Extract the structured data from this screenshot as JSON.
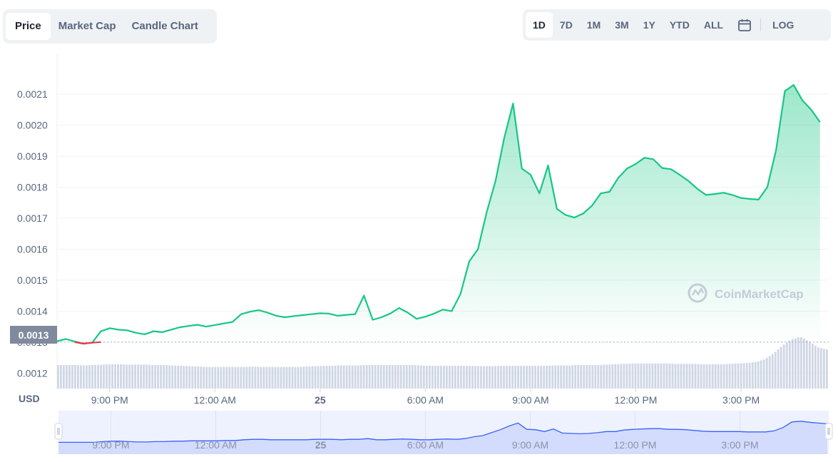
{
  "tabs": {
    "price": "Price",
    "market_cap": "Market Cap",
    "candle_chart": "Candle Chart"
  },
  "ranges": {
    "d1": "1D",
    "d7": "7D",
    "m1": "1M",
    "m3": "3M",
    "y1": "1Y",
    "ytd": "YTD",
    "all": "ALL",
    "log": "LOG"
  },
  "watermark": "CoinMarketCap",
  "currency_label": "USD",
  "colors": {
    "up": "#16c784",
    "down": "#ea3943",
    "navigator_line": "#3861fb",
    "volume": "#cfd6e4"
  },
  "chart_data": {
    "type": "area",
    "ylim": [
      0.00115,
      0.00222
    ],
    "y_ticks": [
      "0.0012",
      "0.0013",
      "0.0014",
      "0.0015",
      "0.0016",
      "0.0017",
      "0.0018",
      "0.0019",
      "0.0020",
      "0.0021"
    ],
    "x_ticks": [
      "9:00 PM",
      "12:00 AM",
      "25",
      "6:00 AM",
      "9:00 AM",
      "12:00 PM",
      "3:00 PM"
    ],
    "open_price": 0.0013,
    "open_price_label": "0.0013",
    "grid": true,
    "series": [
      {
        "x": [
          "7:30 PM",
          "7:45 PM",
          "8:00 PM",
          "8:15 PM",
          "8:30 PM",
          "8:45 PM",
          "9:00 PM",
          "9:15 PM",
          "9:30 PM",
          "9:45 PM",
          "10:00 PM",
          "10:15 PM",
          "10:30 PM",
          "10:45 PM",
          "11:00 PM",
          "11:15 PM",
          "11:30 PM",
          "11:45 PM",
          "12:00 AM",
          "12:15 AM",
          "12:30 AM",
          "12:45 AM",
          "1:00 AM",
          "1:15 AM",
          "1:30 AM",
          "1:45 AM",
          "2:00 AM",
          "2:15 AM",
          "2:30 AM",
          "2:45 AM",
          "3:00 AM",
          "3:15 AM",
          "3:30 AM",
          "3:45 AM",
          "4:00 AM",
          "4:15 AM",
          "4:30 AM",
          "4:45 AM",
          "5:00 AM",
          "5:15 AM",
          "5:30 AM",
          "5:45 AM",
          "6:00 AM",
          "6:15 AM",
          "6:30 AM",
          "6:45 AM",
          "7:00 AM",
          "7:15 AM",
          "7:30 AM",
          "7:45 AM",
          "8:00 AM",
          "8:15 AM",
          "8:30 AM",
          "8:45 AM",
          "9:00 AM",
          "9:15 AM",
          "9:30 AM",
          "9:45 AM",
          "10:00 AM",
          "10:15 AM",
          "10:30 AM",
          "10:45 AM",
          "11:00 AM",
          "11:15 AM",
          "11:30 AM",
          "11:45 AM",
          "12:00 PM",
          "12:15 PM",
          "12:30 PM",
          "12:45 PM",
          "1:00 PM",
          "1:15 PM",
          "1:30 PM",
          "1:45 PM",
          "2:00 PM",
          "2:15 PM",
          "2:30 PM",
          "2:45 PM",
          "3:00 PM",
          "3:15 PM",
          "3:30 PM",
          "3:45 PM",
          "4:00 PM",
          "4:15 PM",
          "4:30 PM",
          "4:45 PM",
          "5:00 PM",
          "5:15 PM"
        ],
        "values": [
          0.001303,
          0.00131,
          0.001302,
          0.001295,
          0.001298,
          0.001335,
          0.001345,
          0.00134,
          0.001338,
          0.00133,
          0.001325,
          0.001335,
          0.001332,
          0.00134,
          0.001348,
          0.001352,
          0.001356,
          0.00135,
          0.001355,
          0.00136,
          0.001365,
          0.00139,
          0.001398,
          0.001403,
          0.001395,
          0.001385,
          0.00138,
          0.001384,
          0.001387,
          0.00139,
          0.001393,
          0.001392,
          0.001385,
          0.001388,
          0.00139,
          0.00145,
          0.001372,
          0.00138,
          0.001392,
          0.00141,
          0.001395,
          0.001375,
          0.001382,
          0.001392,
          0.001405,
          0.0014,
          0.001455,
          0.00156,
          0.0016,
          0.00172,
          0.00182,
          0.00196,
          0.00207,
          0.00186,
          0.00184,
          0.00178,
          0.00187,
          0.00173,
          0.00171,
          0.001702,
          0.001715,
          0.00174,
          0.00178,
          0.001785,
          0.00183,
          0.00186,
          0.001875,
          0.001895,
          0.00189,
          0.001862,
          0.001858,
          0.00184,
          0.00182,
          0.001795,
          0.001775,
          0.001778,
          0.001782,
          0.001775,
          0.001765,
          0.001762,
          0.00176,
          0.0018,
          0.00192,
          0.00211,
          0.00213,
          0.00208,
          0.00205,
          0.00201
        ]
      }
    ],
    "volume": [
      0.6,
      0.6,
      0.6,
      0.59,
      0.6,
      0.61,
      0.62,
      0.62,
      0.61,
      0.61,
      0.61,
      0.6,
      0.6,
      0.59,
      0.58,
      0.57,
      0.56,
      0.55,
      0.55,
      0.55,
      0.55,
      0.55,
      0.56,
      0.55,
      0.55,
      0.55,
      0.55,
      0.55,
      0.56,
      0.57,
      0.58,
      0.58,
      0.59,
      0.59,
      0.59,
      0.6,
      0.6,
      0.6,
      0.6,
      0.6,
      0.6,
      0.59,
      0.58,
      0.58,
      0.58,
      0.58,
      0.58,
      0.58,
      0.57,
      0.57,
      0.58,
      0.58,
      0.58,
      0.58,
      0.58,
      0.58,
      0.59,
      0.59,
      0.59,
      0.6,
      0.6,
      0.6,
      0.61,
      0.62,
      0.63,
      0.64,
      0.64,
      0.64,
      0.64,
      0.64,
      0.63,
      0.63,
      0.63,
      0.62,
      0.62,
      0.62,
      0.63,
      0.64,
      0.65,
      0.68,
      0.75,
      0.9,
      1.1,
      1.25,
      1.32,
      1.2,
      1.05,
      1.0
    ],
    "navigator": [
      0.3,
      0.3,
      0.3,
      0.3,
      0.3,
      0.32,
      0.33,
      0.33,
      0.32,
      0.31,
      0.31,
      0.32,
      0.32,
      0.33,
      0.33,
      0.34,
      0.34,
      0.34,
      0.34,
      0.35,
      0.35,
      0.37,
      0.38,
      0.38,
      0.37,
      0.37,
      0.37,
      0.37,
      0.37,
      0.38,
      0.38,
      0.38,
      0.37,
      0.38,
      0.38,
      0.4,
      0.37,
      0.37,
      0.38,
      0.39,
      0.38,
      0.37,
      0.37,
      0.38,
      0.39,
      0.38,
      0.4,
      0.45,
      0.48,
      0.56,
      0.64,
      0.74,
      0.82,
      0.65,
      0.64,
      0.59,
      0.66,
      0.55,
      0.54,
      0.53,
      0.54,
      0.56,
      0.59,
      0.59,
      0.63,
      0.65,
      0.66,
      0.67,
      0.67,
      0.65,
      0.65,
      0.64,
      0.62,
      0.6,
      0.59,
      0.59,
      0.59,
      0.59,
      0.58,
      0.58,
      0.58,
      0.61,
      0.7,
      0.85,
      0.87,
      0.84,
      0.82,
      0.8
    ]
  }
}
